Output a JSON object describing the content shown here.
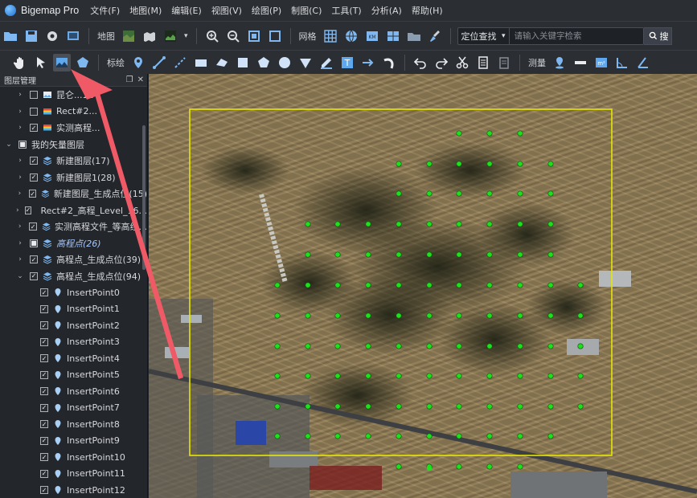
{
  "app": {
    "title": "Bigemap Pro"
  },
  "menu": [
    "文件(F)",
    "地图(M)",
    "编辑(E)",
    "视图(V)",
    "绘图(P)",
    "制图(C)",
    "工具(T)",
    "分析(A)",
    "帮助(H)"
  ],
  "toolbar1": {
    "map_label": "地图",
    "grid_label": "网格",
    "locator": {
      "mode": "定位查找",
      "placeholder": "请输入关键字检索",
      "search_label": "搜"
    }
  },
  "toolbar2": {
    "annotate_label": "标绘",
    "measure_label": "测量"
  },
  "panel": {
    "title": "图层管理",
    "rows": [
      {
        "label": "昆仑...12",
        "italic": false
      },
      {
        "label": "Rect#2...",
        "italic": false
      },
      {
        "label": "实测高程...",
        "italic": false
      },
      {
        "label": "我的矢量图层",
        "italic": false
      },
      {
        "label": "新建图层(17)",
        "italic": false
      },
      {
        "label": "新建图层1(28)",
        "italic": false
      },
      {
        "label": "新建图层_生成点位(15)",
        "italic": false
      },
      {
        "label": "Rect#2_高程_Level_16...",
        "italic": false
      },
      {
        "label": "实测高程文件_等高线...",
        "italic": false
      },
      {
        "label": "高程点(26)",
        "italic": true
      },
      {
        "label": "高程点_生成点位(39)",
        "italic": false
      },
      {
        "label": "高程点_生成点位(94)",
        "italic": false
      },
      {
        "label": "InsertPoint0",
        "italic": false
      },
      {
        "label": "InsertPoint1",
        "italic": false
      },
      {
        "label": "InsertPoint2",
        "italic": false
      },
      {
        "label": "InsertPoint3",
        "italic": false
      },
      {
        "label": "InsertPoint4",
        "italic": false
      },
      {
        "label": "InsertPoint5",
        "italic": false
      },
      {
        "label": "InsertPoint6",
        "italic": false
      },
      {
        "label": "InsertPoint7",
        "italic": false
      },
      {
        "label": "InsertPoint8",
        "italic": false
      },
      {
        "label": "InsertPoint9",
        "italic": false
      },
      {
        "label": "InsertPoint10",
        "italic": false
      },
      {
        "label": "InsertPoint11",
        "italic": false
      },
      {
        "label": "InsertPoint12",
        "italic": false
      }
    ]
  },
  "colors": {
    "accent_point": "#1fe01f",
    "rect_border": "#e6e600",
    "annotation_arrow": "#f05a66"
  }
}
